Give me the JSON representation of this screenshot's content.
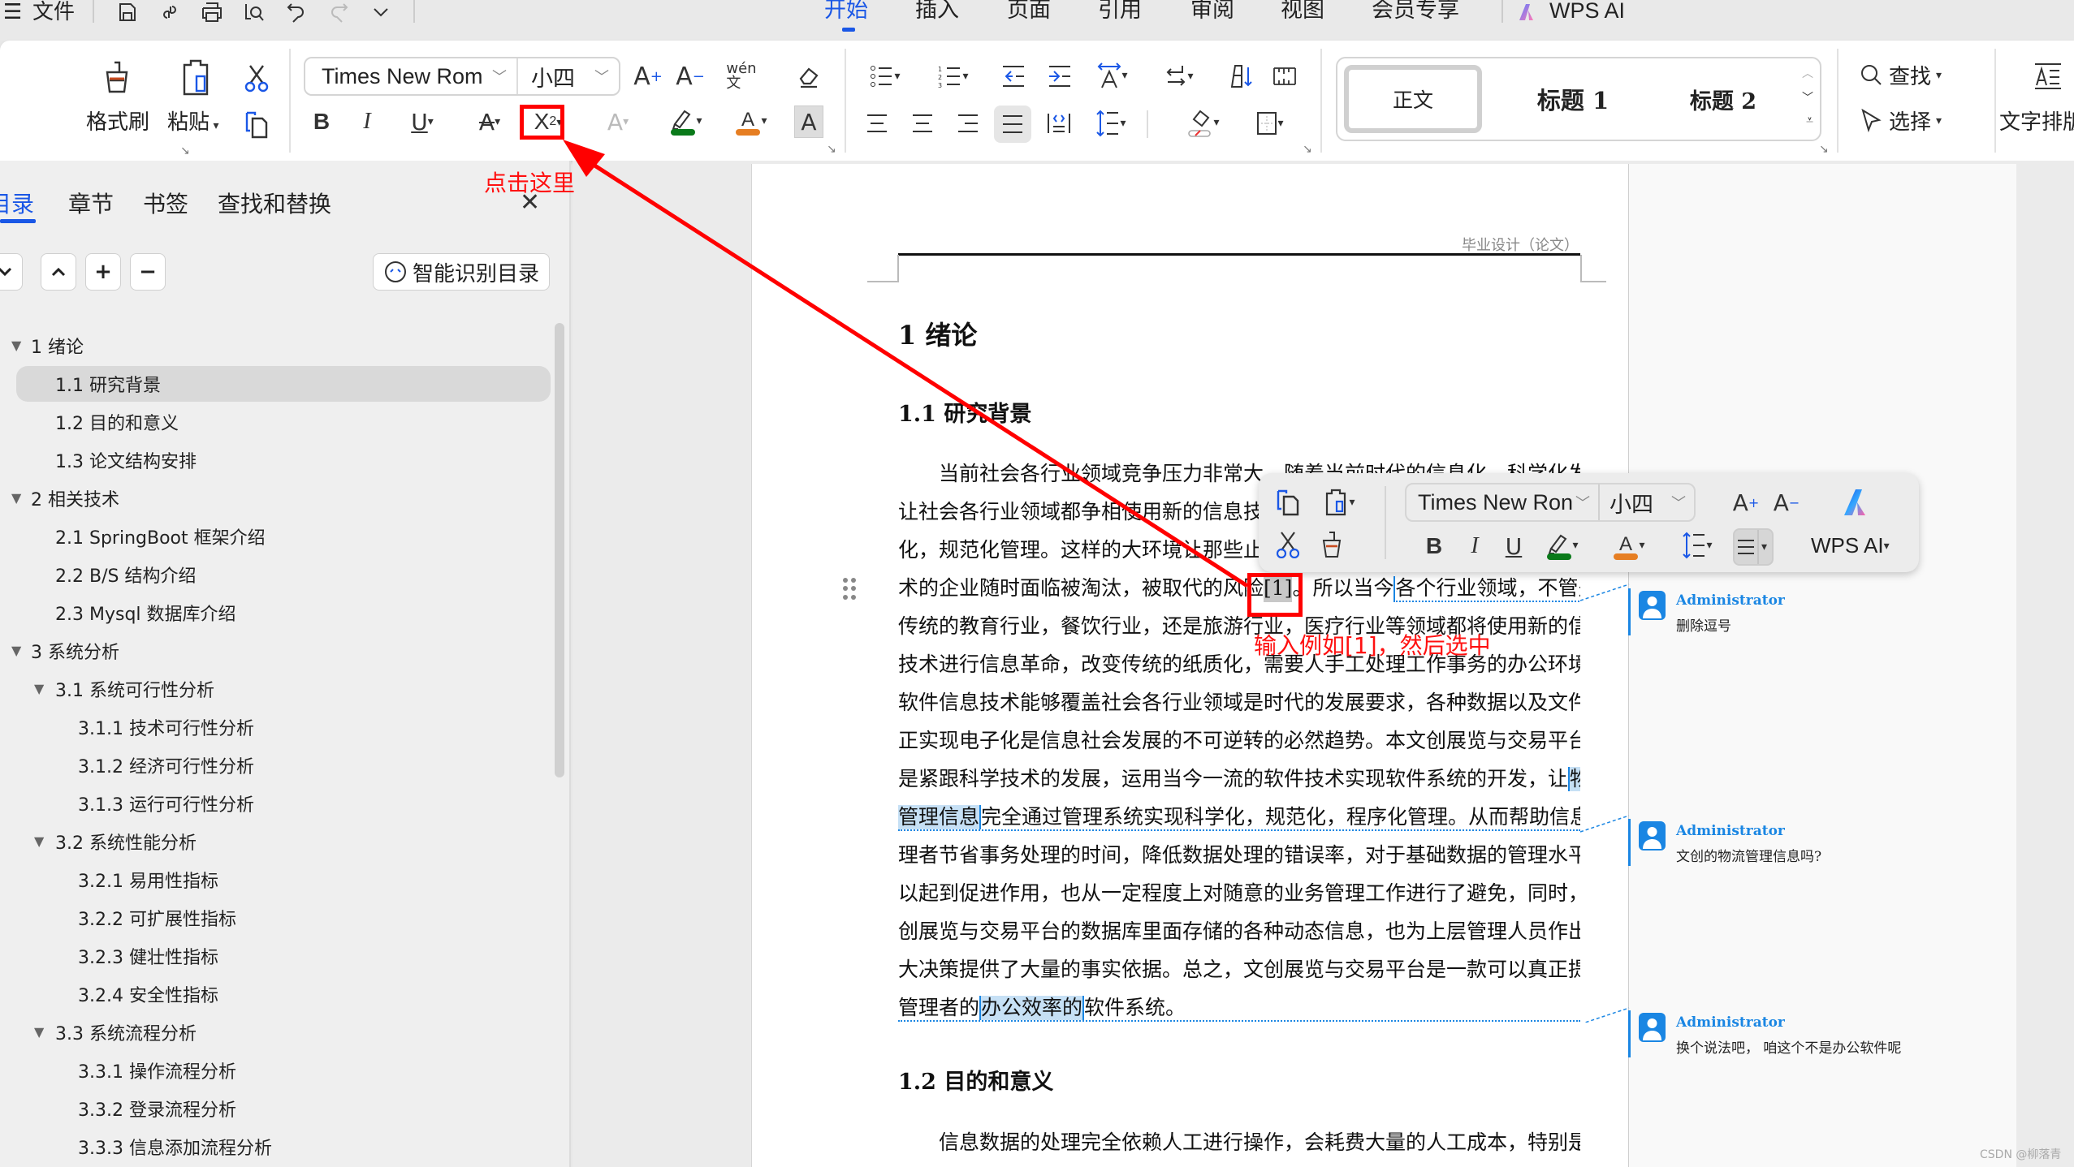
{
  "topbar": {
    "menu_label": "文件",
    "quick_icons": [
      "save-icon",
      "link-icon",
      "print-icon",
      "print-preview-icon",
      "undo-icon",
      "redo-icon",
      "more-chevron-icon"
    ],
    "tabs": [
      {
        "label": "开始",
        "active": true
      },
      {
        "label": "插入"
      },
      {
        "label": "页面"
      },
      {
        "label": "引用"
      },
      {
        "label": "审阅"
      },
      {
        "label": "视图"
      },
      {
        "label": "会员专享"
      }
    ],
    "ai_label": "WPS AI"
  },
  "ribbon": {
    "format_painter": "格式刷",
    "paste": "粘贴",
    "font_name": "Times New Rom",
    "font_size": "小四",
    "styles": [
      "正文",
      "标题 1",
      "标题 2"
    ],
    "find": "查找",
    "select": "选择",
    "text_layout": "文字排版",
    "font_color_swatch": "#e67e22",
    "highlight_swatch": "#0a7a1a",
    "accent": "#1a57e6"
  },
  "nav": {
    "tabs": [
      "目录",
      "章节",
      "书签",
      "查找和替换"
    ],
    "active_tab": "目录",
    "smart_button": "智能识别目录",
    "toc": [
      {
        "label": "1  绪论",
        "level": 1,
        "expanded": true
      },
      {
        "label": "1.1  研究背景",
        "level": 2,
        "selected": true
      },
      {
        "label": "1.2  目的和意义",
        "level": 2
      },
      {
        "label": "1.3  论文结构安排",
        "level": 2
      },
      {
        "label": "2  相关技术",
        "level": 1,
        "expanded": true
      },
      {
        "label": "2.1 SpringBoot 框架介绍",
        "level": 2
      },
      {
        "label": "2.2 B/S 结构介绍",
        "level": 2
      },
      {
        "label": "2.3 Mysql 数据库介绍",
        "level": 2
      },
      {
        "label": "3  系统分析",
        "level": 1,
        "expanded": true
      },
      {
        "label": "3.1  系统可行性分析",
        "level": 2,
        "expanded": true
      },
      {
        "label": "3.1.1  技术可行性分析",
        "level": 3
      },
      {
        "label": "3.1.2  经济可行性分析",
        "level": 3
      },
      {
        "label": "3.1.3  运行可行性分析",
        "level": 3
      },
      {
        "label": "3.2  系统性能分析",
        "level": 2,
        "expanded": true
      },
      {
        "label": "3.2.1  易用性指标",
        "level": 3
      },
      {
        "label": "3.2.2  可扩展性指标",
        "level": 3
      },
      {
        "label": "3.2.3  健壮性指标",
        "level": 3
      },
      {
        "label": "3.2.4  安全性指标",
        "level": 3
      },
      {
        "label": "3.3  系统流程分析",
        "level": 2,
        "expanded": true
      },
      {
        "label": "3.3.1  操作流程分析",
        "level": 3
      },
      {
        "label": "3.3.2  登录流程分析",
        "level": 3
      },
      {
        "label": "3.3.3  信息添加流程分析",
        "level": 3
      }
    ]
  },
  "document": {
    "header": "毕业设计（论文）",
    "h1": "1  绪论",
    "h2_1": "1.1  研究背景",
    "h2_2": "1.2  目的和意义",
    "lines": [
      "　　当前社会各行业领域竞争压力非常大，随着当前时代的信息化，科学化发展，",
      "让社会各行业领域都争相使用新的信息技术，",
      "化，规范化管理。这样的大环境让那些止步",
      "术的企业随时面临被淘汰，被取代的风险",
      "传统的教育行业，餐饮行业，还是旅游行业，医疗行业等领域都将使用新的信息",
      "技术进行信息革命，改变传统的纸质化，需要人手工处理工作事务的办公环境。",
      "软件信息技术能够覆盖社会各行业领域是时代的发展要求，各种数据以及文件真",
      "正实现电子化是信息社会发展的不可逆转的必然趋势。本文创展览与交易平台也",
      "是紧跟科学技术的发展，运用当今一流的软件技术实现软件系统的开发，让",
      "管理信息",
      "理者节省事务处理的时间，降低数据处理的错误率，对于基础数据的管理水平可",
      "以起到促进作用，也从一定程度上对随意的业务管理工作进行了避免，同时，文",
      "创展览与交易平台的数据库里面存储的各种动态信息，也为上层管理人员作出重",
      "大决策提供了大量的事实依据。总之，文创展览与交易平台是一款可以真正提升",
      "管理者的"
    ],
    "line4_citation": "[1]",
    "line4_tail": "。所以当今",
    "line4_hl": "各个行业领域，不管是",
    "line9_hl": "物流",
    "line10_tail": "完全通过管理系统实现科学化，规范化，程序化管理。从而帮助信息管",
    "line15_hl": "办公效率的",
    "line15_tail": "软件系统。",
    "para2_line1": "　　信息数据的处理完全依赖人工进行操作，会耗费大量的人工成本，特别是面"
  },
  "comments": [
    {
      "author": "Administrator",
      "text": "删除逗号"
    },
    {
      "author": "Administrator",
      "text": "文创的物流管理信息吗?"
    },
    {
      "author": "Administrator",
      "text": "换个说法吧，  咱这个不是办公软件呢"
    }
  ],
  "minibar": {
    "font_name": "Times New Ron",
    "font_size": "小四",
    "ai_label": "WPS AI"
  },
  "annotations": {
    "click_here": "点击这里",
    "instruction": "输入例如[1]，然后选中",
    "color": "#ff0000"
  },
  "watermark": "CSDN @柳落青"
}
